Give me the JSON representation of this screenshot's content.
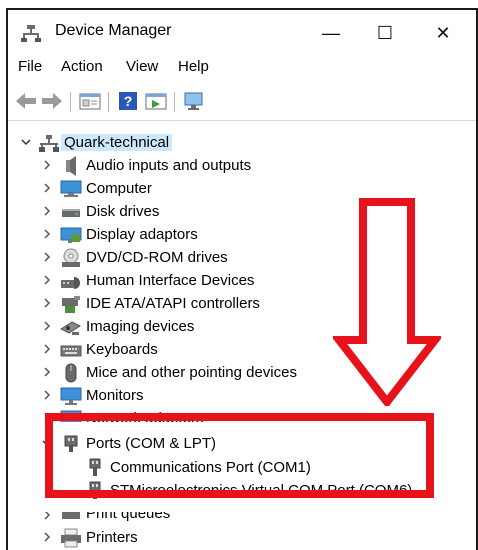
{
  "window": {
    "title": "Device Manager",
    "controls": {
      "minimize": "—",
      "maximize": "☐",
      "close": "✕"
    }
  },
  "menu": {
    "items": [
      "File",
      "Action",
      "View",
      "Help"
    ]
  },
  "tree": {
    "root": "Quark-technical",
    "categories": [
      {
        "label": "Audio inputs and outputs",
        "icon": "speaker-icon"
      },
      {
        "label": "Computer",
        "icon": "computer-icon"
      },
      {
        "label": "Disk drives",
        "icon": "disk-drive-icon"
      },
      {
        "label": "Display adaptors",
        "icon": "display-adapter-icon"
      },
      {
        "label": "DVD/CD-ROM drives",
        "icon": "dvd-drive-icon"
      },
      {
        "label": "Human Interface Devices",
        "icon": "hid-icon"
      },
      {
        "label": "IDE ATA/ATAPI controllers",
        "icon": "ide-controller-icon"
      },
      {
        "label": "Imaging devices",
        "icon": "camera-icon"
      },
      {
        "label": "Keyboards",
        "icon": "keyboard-icon"
      },
      {
        "label": "Mice and other pointing devices",
        "icon": "mouse-icon"
      },
      {
        "label": "Monitors",
        "icon": "monitor-icon"
      },
      {
        "label": "Network adapters",
        "icon": "network-adapter-icon"
      }
    ],
    "ports": {
      "label": "Ports (COM & LPT)",
      "children": [
        "Communications Port (COM1)",
        "STMicroelectronics Virtual COM Port (COM6)"
      ]
    },
    "after": [
      {
        "label": "Print queues",
        "icon": "print-queue-icon"
      },
      {
        "label": "Printers",
        "icon": "printer-icon"
      }
    ]
  },
  "colors": {
    "highlight": "#e8121b",
    "selection": "#cce8ff"
  }
}
